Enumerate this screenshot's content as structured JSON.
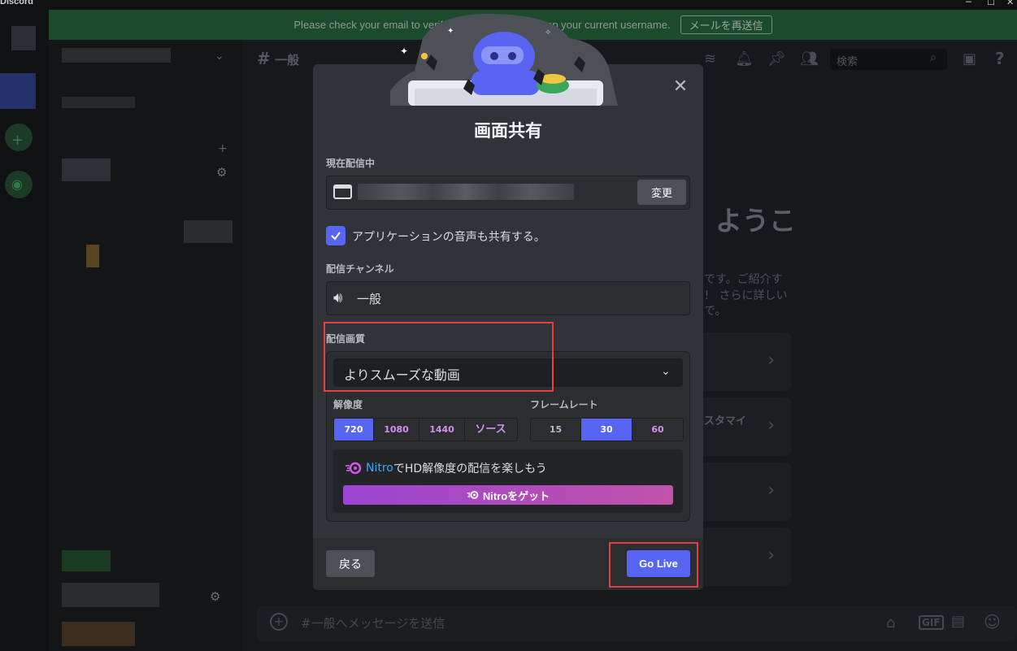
{
  "app": {
    "title": "Discord"
  },
  "banner": {
    "text": "Please check your email to verify your account and keep your current username.",
    "button": "メールを再送信"
  },
  "channel_header": {
    "name": "一般"
  },
  "search": {
    "placeholder": "検索"
  },
  "background": {
    "welcome_heading": "ようこ",
    "welcome_lines": [
      "です。ご紹介す",
      "！ さらに詳しい",
      "で。"
    ],
    "card_label": "スタマイ"
  },
  "message_input": {
    "placeholder": "#一般へメッセージを送信"
  },
  "dialog": {
    "title": "画面共有",
    "current_label": "現在配信中",
    "change_button": "変更",
    "share_audio_label": "アプリケーションの音声も共有する。",
    "share_audio_checked": true,
    "channel_label": "配信チャンネル",
    "channel_name": "一般",
    "quality_label": "配信画質",
    "quality_value": "よりスムーズな動画",
    "resolution_label": "解像度",
    "resolutions": [
      "720",
      "1080",
      "1440",
      "ソース"
    ],
    "resolution_selected": "720",
    "framerate_label": "フレームレート",
    "framerates": [
      "15",
      "30",
      "60"
    ],
    "framerate_selected": "30",
    "nitro_brand": "Nitro",
    "nitro_text": "でHD解像度の配信を楽しもう",
    "nitro_button": "Nitroをゲット",
    "back_button": "戻る",
    "golive_button": "Go Live"
  },
  "colors": {
    "accent": "#5865f2",
    "dialog_bg": "#313338",
    "highlight": "#e04141",
    "nitro": "#3ea7f0"
  }
}
